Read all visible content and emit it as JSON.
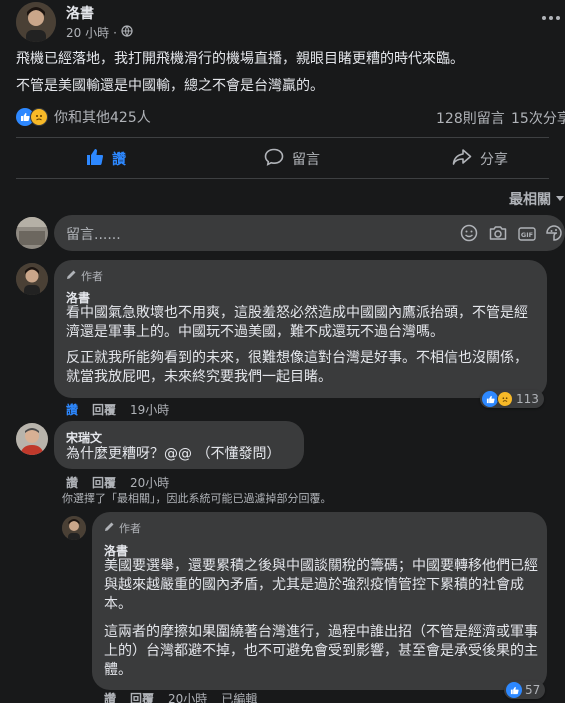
{
  "post": {
    "author": "洛書",
    "time": "20 小時",
    "paragraphs": [
      "飛機已經落地，我打開飛機滑行的機場直播，親眼目睹更糟的時代來臨。",
      "不管是美國輸還是中國輸，總之不會是台灣贏的。"
    ],
    "reactions_text": "你和其他425人",
    "comments_count": "128則留言",
    "shares_count": "15次分享"
  },
  "actions": {
    "like": "讚",
    "comment": "留言",
    "share": "分享"
  },
  "sort_label": "最相關",
  "composer": {
    "placeholder": "留言......"
  },
  "comments": [
    {
      "badge": "作者",
      "name": "洛書",
      "paragraphs": [
        "看中國氣急敗壞也不用爽，這股羞怒必然造成中國國內鷹派抬頭，不管是經濟還是軍事上的。中國玩不過美國，難不成還玩不過台灣嗎。",
        "反正就我所能夠看到的未來，很難想像這對台灣是好事。不相信也沒關係，就當我放屁吧，未來終究要我們一起目睹。"
      ],
      "like": "讚",
      "reply": "回覆",
      "time": "19小時",
      "reaction_count": "113"
    },
    {
      "name": "宋瑞文",
      "text": "為什麼更糟呀？@@ （不懂發問）",
      "like": "讚",
      "reply": "回覆",
      "time": "20小時",
      "filter_note": "你選擇了「最相關」，因此系統可能已過濾掉部分回覆。"
    },
    {
      "badge": "作者",
      "name": "洛書",
      "paragraphs": [
        "美國要選舉，還要累積之後與中國談關稅的籌碼；中國要轉移他們已經與越來越嚴重的國內矛盾，尤其是過於強烈疫情管控下累積的社會成本。",
        "這兩者的摩擦如果圍繞著台灣進行，過程中誰出招（不管是經濟或軍事上的）台灣都避不掉，也不可避免會受到影響，甚至會是承受後果的主體。"
      ],
      "like": "讚",
      "reply": "回覆",
      "time": "20小時",
      "edited": "已編輯",
      "reaction_count": "57"
    }
  ],
  "colors": {
    "background": "#18191a",
    "bubble": "#3a3b3c",
    "accent": "#2d88ff",
    "text": "#e4e6eb",
    "muted": "#b0b3b8"
  }
}
